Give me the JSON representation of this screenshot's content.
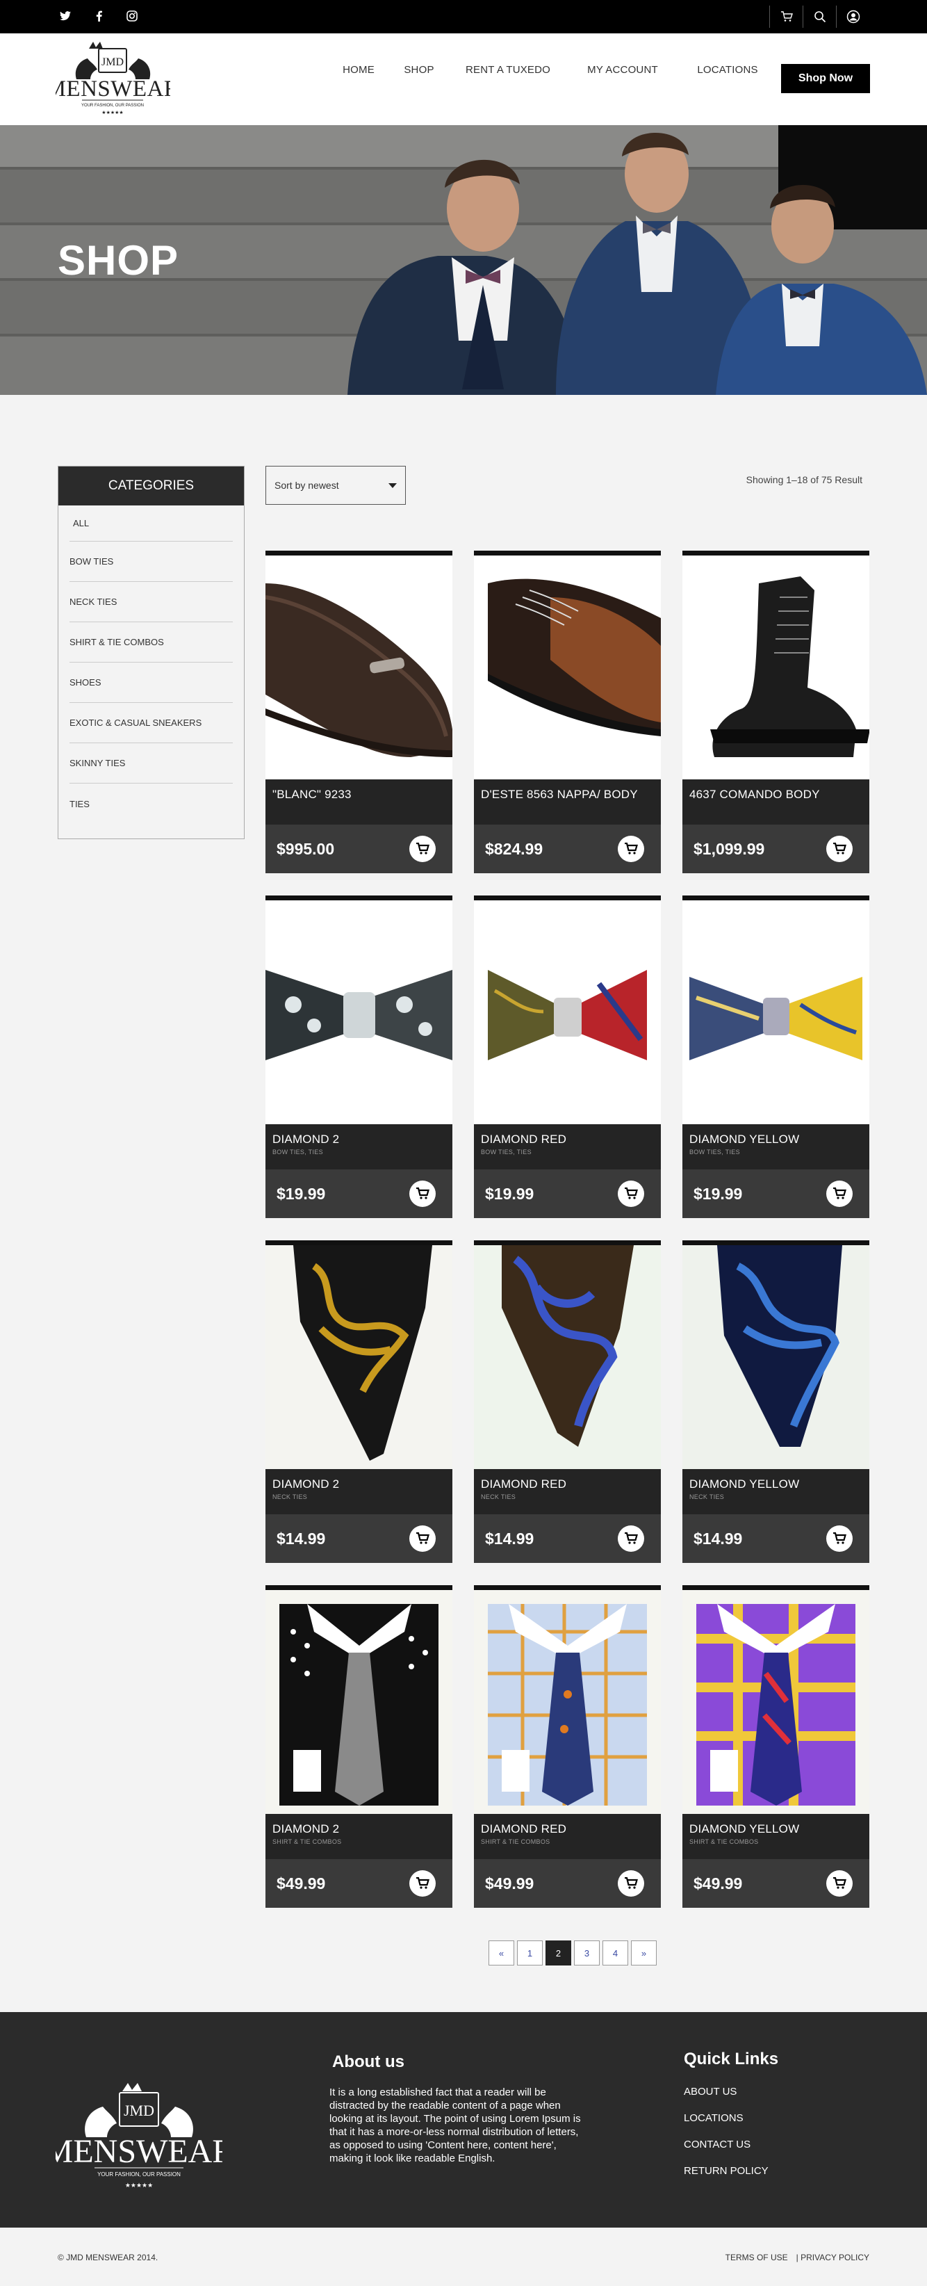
{
  "topbar": {
    "social_icons": [
      "twitter-icon",
      "facebook-icon",
      "instagram-icon"
    ],
    "right_icons": [
      "cart-icon",
      "search-icon",
      "user-icon"
    ]
  },
  "header": {
    "logo_text": "MENSWEAR",
    "logo_monogram": "JMD",
    "logo_tagline": "YOUR FASHION, OUR PASSION",
    "nav": [
      "HOME",
      "SHOP",
      "RENT A TUXEDO",
      "MY ACCOUNT",
      "LOCATIONS"
    ],
    "cta": "Shop Now"
  },
  "hero": {
    "title": "SHOP"
  },
  "sidebar": {
    "title": "CATEGORIES",
    "items": [
      "ALL",
      "BOW TIES",
      "NECK TIES",
      "SHIRT & TIE COMBOS",
      "SHOES",
      "EXOTIC & CASUAL SNEAKERS",
      "SKINNY TIES",
      "TIES"
    ]
  },
  "toolbar": {
    "sort_label": "Sort by newest",
    "result_text": "Showing  1–18 of  75  Result"
  },
  "products": [
    {
      "name": "\"BLANC\" 9233",
      "category": "",
      "price": "$995.00",
      "image": "loafer"
    },
    {
      "name": "D'ESTE 8563 NAPPA/ BODY",
      "category": "",
      "price": "$824.99",
      "image": "oxford"
    },
    {
      "name": "4637 COMANDO BODY",
      "category": "",
      "price": "$1,099.99",
      "image": "boot"
    },
    {
      "name": "DIAMOND 2",
      "category": "BOW TIES, TIES",
      "price": "$19.99",
      "image": "bowtie-grey"
    },
    {
      "name": "DIAMOND RED",
      "category": "BOW TIES, TIES",
      "price": "$19.99",
      "image": "bowtie-red"
    },
    {
      "name": "DIAMOND YELLOW",
      "category": "BOW TIES, TIES",
      "price": "$19.99",
      "image": "bowtie-yellow"
    },
    {
      "name": "DIAMOND 2",
      "category": "NECK TIES",
      "price": "$14.99",
      "image": "tie-gold"
    },
    {
      "name": "DIAMOND RED",
      "category": "NECK TIES",
      "price": "$14.99",
      "image": "tie-blue-brown"
    },
    {
      "name": "DIAMOND YELLOW",
      "category": "NECK TIES",
      "price": "$14.99",
      "image": "tie-navy"
    },
    {
      "name": "DIAMOND 2",
      "category": "SHIRT & TIE COMBOS",
      "price": "$49.99",
      "image": "shirt-polka"
    },
    {
      "name": "DIAMOND RED",
      "category": "SHIRT & TIE COMBOS",
      "price": "$49.99",
      "image": "shirt-check-blue"
    },
    {
      "name": "DIAMOND YELLOW",
      "category": "SHIRT & TIE COMBOS",
      "price": "$49.99",
      "image": "shirt-check-purple"
    }
  ],
  "pagination": [
    "«",
    "1",
    "2",
    "3",
    "4",
    "»"
  ],
  "pagination_active": "2",
  "footer": {
    "about_title": "About us",
    "about_text": "It is a long established fact that a reader will be distracted by the readable content of a page when looking at its layout. The point of using Lorem Ipsum is that it has a more-or-less normal distribution of letters, as opposed to using 'Content here, content here', making it look like readable English.",
    "quick_links_title": "Quick Links",
    "quick_links": [
      "ABOUT US",
      "LOCATIONS",
      "CONTACT US",
      "RETURN POLICY"
    ],
    "copyright": "© JMD MENSWEAR 2014.",
    "legal_links": [
      "TERMS OF USE",
      "| PRIVACY POLICY"
    ]
  },
  "colors": {
    "dark": "#242424",
    "black": "#000000",
    "bg": "#f3f3f3",
    "pager_link": "#3a4aa3"
  }
}
